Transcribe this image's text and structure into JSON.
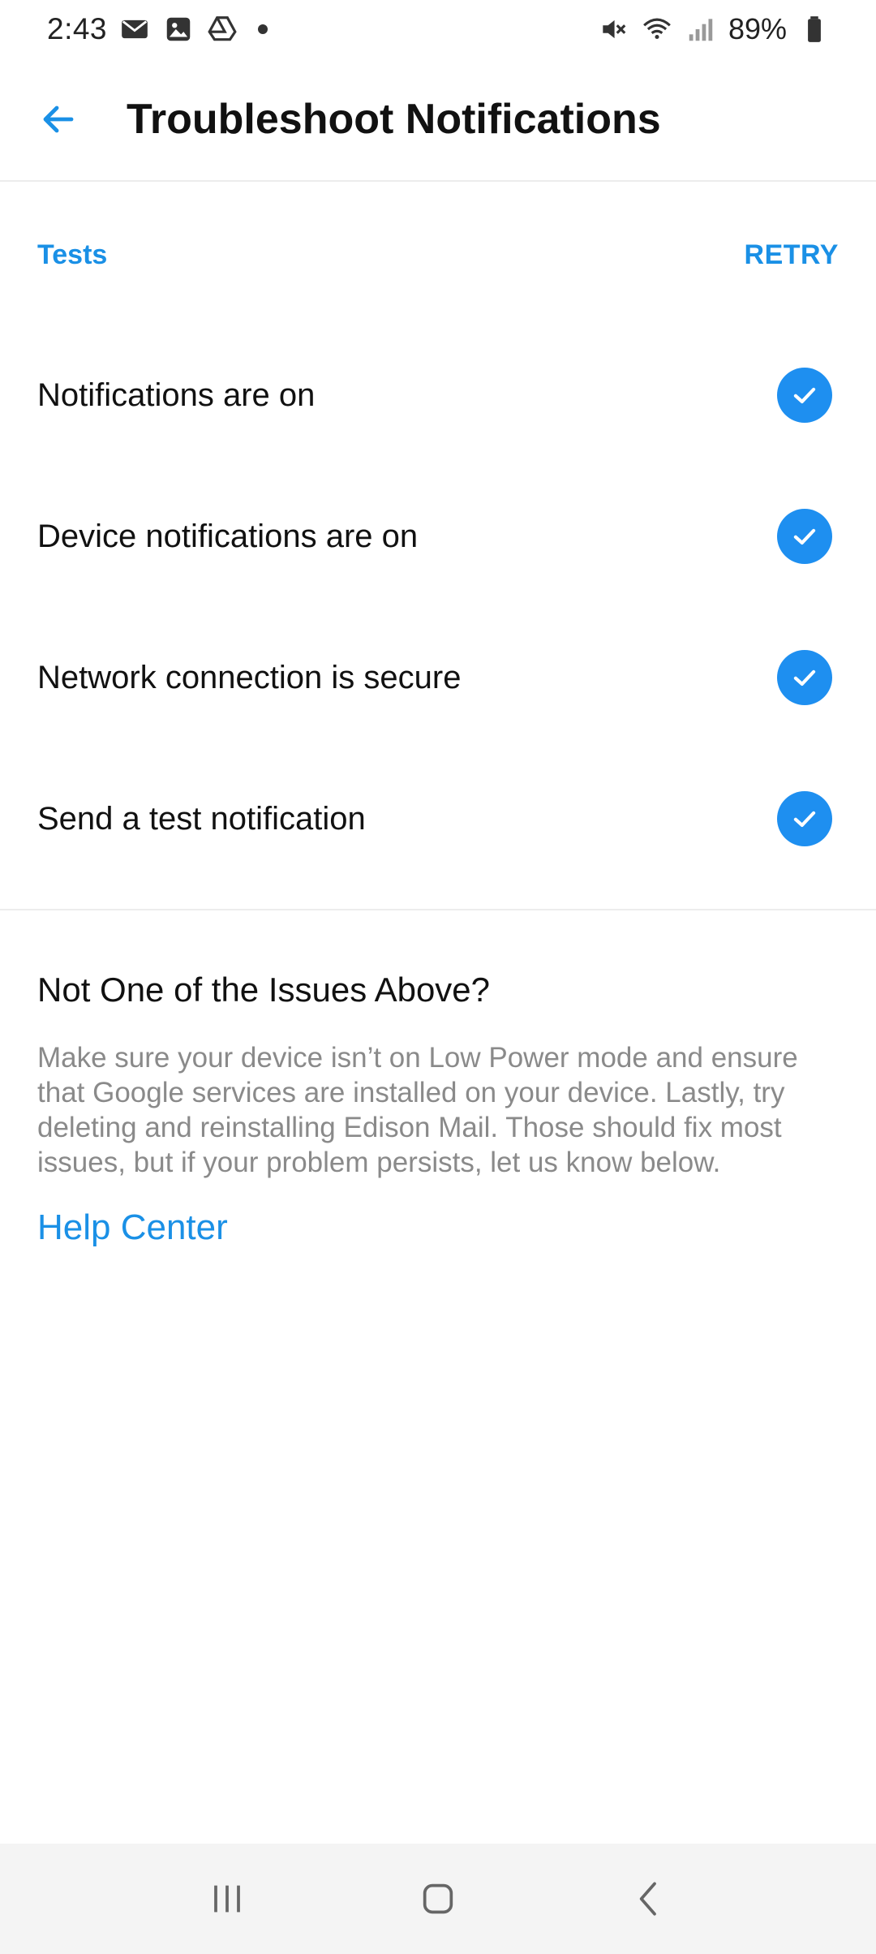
{
  "status_bar": {
    "time": "2:43",
    "left_icons": [
      "gmail-icon",
      "gallery-icon",
      "drive-icon",
      "notification-dot"
    ],
    "right_icons": [
      "mute-icon",
      "wifi-icon",
      "signal-icon",
      "battery-icon"
    ],
    "battery": "89%"
  },
  "app_bar": {
    "title": "Troubleshoot Notifications",
    "back_icon": "arrow-left-icon"
  },
  "tests": {
    "section_label": "Tests",
    "retry_label": "RETRY",
    "items": [
      {
        "label": "Notifications are on",
        "status": "passed"
      },
      {
        "label": "Device notifications are on",
        "status": "passed"
      },
      {
        "label": "Network connection is secure",
        "status": "passed"
      },
      {
        "label": "Send a test notification",
        "status": "passed"
      }
    ]
  },
  "help": {
    "title": "Not One of the Issues Above?",
    "body": "Make sure your device isn’t on Low Power mode and ensure that Google services are installed on your device. Lastly, try deleting and reinstalling Edison Mail. Those should fix most issues, but if your problem persists, let us know below.",
    "link_label": "Help Center"
  },
  "nav_bar": {
    "buttons": [
      "recents-icon",
      "home-icon",
      "back-icon"
    ]
  },
  "colors": {
    "accent": "#1a90e6",
    "check_badge": "#1e8ff0",
    "body_text": "#111111",
    "muted_text": "#8a8a8a",
    "nav_background": "#f4f4f4"
  }
}
